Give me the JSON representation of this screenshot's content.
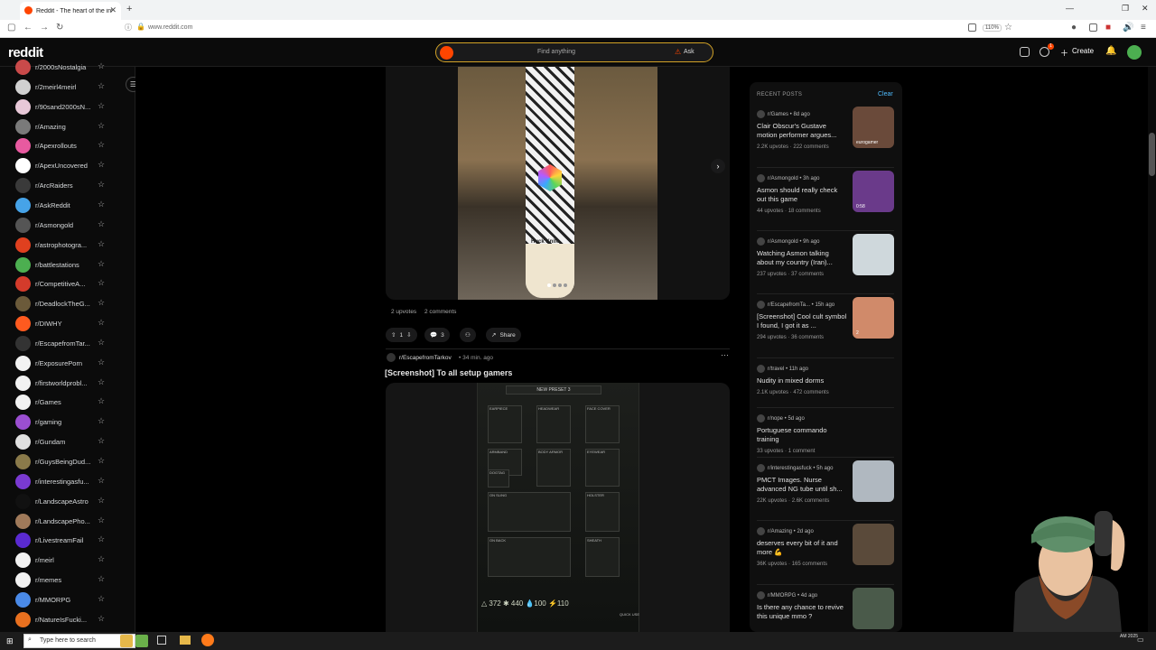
{
  "browser": {
    "tab_title": "Reddit - The heart of the internet",
    "new_tab": "+",
    "url": "www.reddit.com",
    "zoom": "110%"
  },
  "header": {
    "logo": "reddit",
    "search_placeholder": "Find anything",
    "ask_label": "Ask",
    "create_label": "Create",
    "notification_count": "1"
  },
  "sidebar": {
    "items": [
      {
        "label": "r/2000sNostalgia",
        "color": "#c94a4a"
      },
      {
        "label": "r/2meirl4meirl",
        "color": "#d0d0d0"
      },
      {
        "label": "r/90sand2000sN...",
        "color": "#e8c8d8"
      },
      {
        "label": "r/Amazing",
        "color": "#7a7a7a"
      },
      {
        "label": "r/Apexrollouts",
        "color": "#e85aa0"
      },
      {
        "label": "r/ApexUncovered",
        "color": "#ffffff"
      },
      {
        "label": "r/ArcRaiders",
        "color": "#3a3a3a"
      },
      {
        "label": "r/AskReddit",
        "color": "#46a3e8"
      },
      {
        "label": "r/Asmongold",
        "color": "#555555"
      },
      {
        "label": "r/astrophotogra...",
        "color": "#e0401f"
      },
      {
        "label": "r/battlestations",
        "color": "#4caf50"
      },
      {
        "label": "r/CompetitiveA...",
        "color": "#d43b2b"
      },
      {
        "label": "r/DeadlockTheG...",
        "color": "#6b5a3a"
      },
      {
        "label": "r/DIWHY",
        "color": "#ff5a1f"
      },
      {
        "label": "r/EscapefromTar...",
        "color": "#333333"
      },
      {
        "label": "r/ExposurePorn",
        "color": "#f2f2f2"
      },
      {
        "label": "r/firstworldprobl...",
        "color": "#f2f2f2"
      },
      {
        "label": "r/Games",
        "color": "#f2f2f2"
      },
      {
        "label": "r/gaming",
        "color": "#9b4fd1"
      },
      {
        "label": "r/Gundam",
        "color": "#e0e0e0"
      },
      {
        "label": "r/GuysBeingDud...",
        "color": "#8a7a4a"
      },
      {
        "label": "r/interestingasfu...",
        "color": "#7a3ad1"
      },
      {
        "label": "r/LandscapeAstro",
        "color": "#111111"
      },
      {
        "label": "r/LandscapePho...",
        "color": "#a07a5a"
      },
      {
        "label": "r/LivestreamFail",
        "color": "#5a2ad1"
      },
      {
        "label": "r/meirl",
        "color": "#f2f2f2"
      },
      {
        "label": "r/memes",
        "color": "#f2f2f2"
      },
      {
        "label": "r/MMORPG",
        "color": "#4a8ae8"
      },
      {
        "label": "r/NatureIsFucki...",
        "color": "#e8701f"
      }
    ]
  },
  "post1": {
    "upvotes": "2 upvotes",
    "comments": "2 comments",
    "vote_count": "1",
    "comment_count": "3",
    "share_label": "Share",
    "board_text": "Huck Knife"
  },
  "post2": {
    "subreddit": "r/EscapefromTarkov",
    "time": "• 34 min. ago",
    "title": "[Screenshot] To all setup gamers",
    "preset_title": "NEW PRESET 3",
    "slots": [
      "EARPIECE",
      "HEADWEAR",
      "FACE COVER",
      "ARMBAND",
      "BODY ARMOR",
      "EYEWEAR",
      "DOGTAG",
      "ON SLING",
      "HOLSTER",
      "ON BACK",
      "SHEATH"
    ],
    "stats": "△ 372  ✱ 440  💧100  ⚡110",
    "quick_use": "QUICK USE"
  },
  "recent": {
    "heading": "RECENT POSTS",
    "clear_label": "Clear",
    "posts": [
      {
        "sub": "r/Games • 8d ago",
        "title": "Clair Obscur's Gustave motion performer argues...",
        "meta": "2.2K upvotes · 222 comments",
        "thumb": "#6a4a3a",
        "thumb_text": "eurogamer"
      },
      {
        "sub": "r/Asmongold • 3h ago",
        "title": "Asmon should really check out this game",
        "meta": "44 upvotes · 18 comments",
        "thumb": "#6a3a8a",
        "thumb_text": "0:58"
      },
      {
        "sub": "r/Asmongold • 9h ago",
        "title": "Watching Asmon talking about my country (Iran)...",
        "meta": "237 upvotes · 37 comments",
        "thumb": "#cfd8dc",
        "thumb_text": ""
      },
      {
        "sub": "r/EscapefromTa... • 15h ago",
        "title": "[Screenshot] Cool cult symbol I found, I got it as ...",
        "meta": "294 upvotes · 36 comments",
        "thumb": "#d08a6a",
        "thumb_text": "2"
      },
      {
        "sub": "r/travel • 11h ago",
        "title": "Nudity in mixed dorms",
        "meta": "2.1K upvotes · 472 comments",
        "thumb": "",
        "thumb_text": ""
      },
      {
        "sub": "r/nope • 5d ago",
        "title": "Portuguese commando training",
        "meta": "33 upvotes · 1 comment",
        "thumb": "",
        "thumb_text": ""
      },
      {
        "sub": "r/interestingasfuck • 5h ago",
        "title": "PMCT Images. Nurse advanced NG tube until sh...",
        "meta": "22K upvotes · 2.6K comments",
        "thumb": "#b0b8c0",
        "thumb_text": ""
      },
      {
        "sub": "r/Amazing • 2d ago",
        "title": "deserves every bit of it and more 💪",
        "meta": "36K upvotes · 165 comments",
        "thumb": "#5a4a3a",
        "thumb_text": ""
      },
      {
        "sub": "r/MMORPG • 4d ago",
        "title": "Is there any chance to revive this unique mmo ?",
        "meta": "",
        "thumb": "#4a5a4a",
        "thumb_text": ""
      }
    ]
  },
  "taskbar": {
    "search_placeholder": "Type here to search",
    "clock": "AM\n2025"
  }
}
